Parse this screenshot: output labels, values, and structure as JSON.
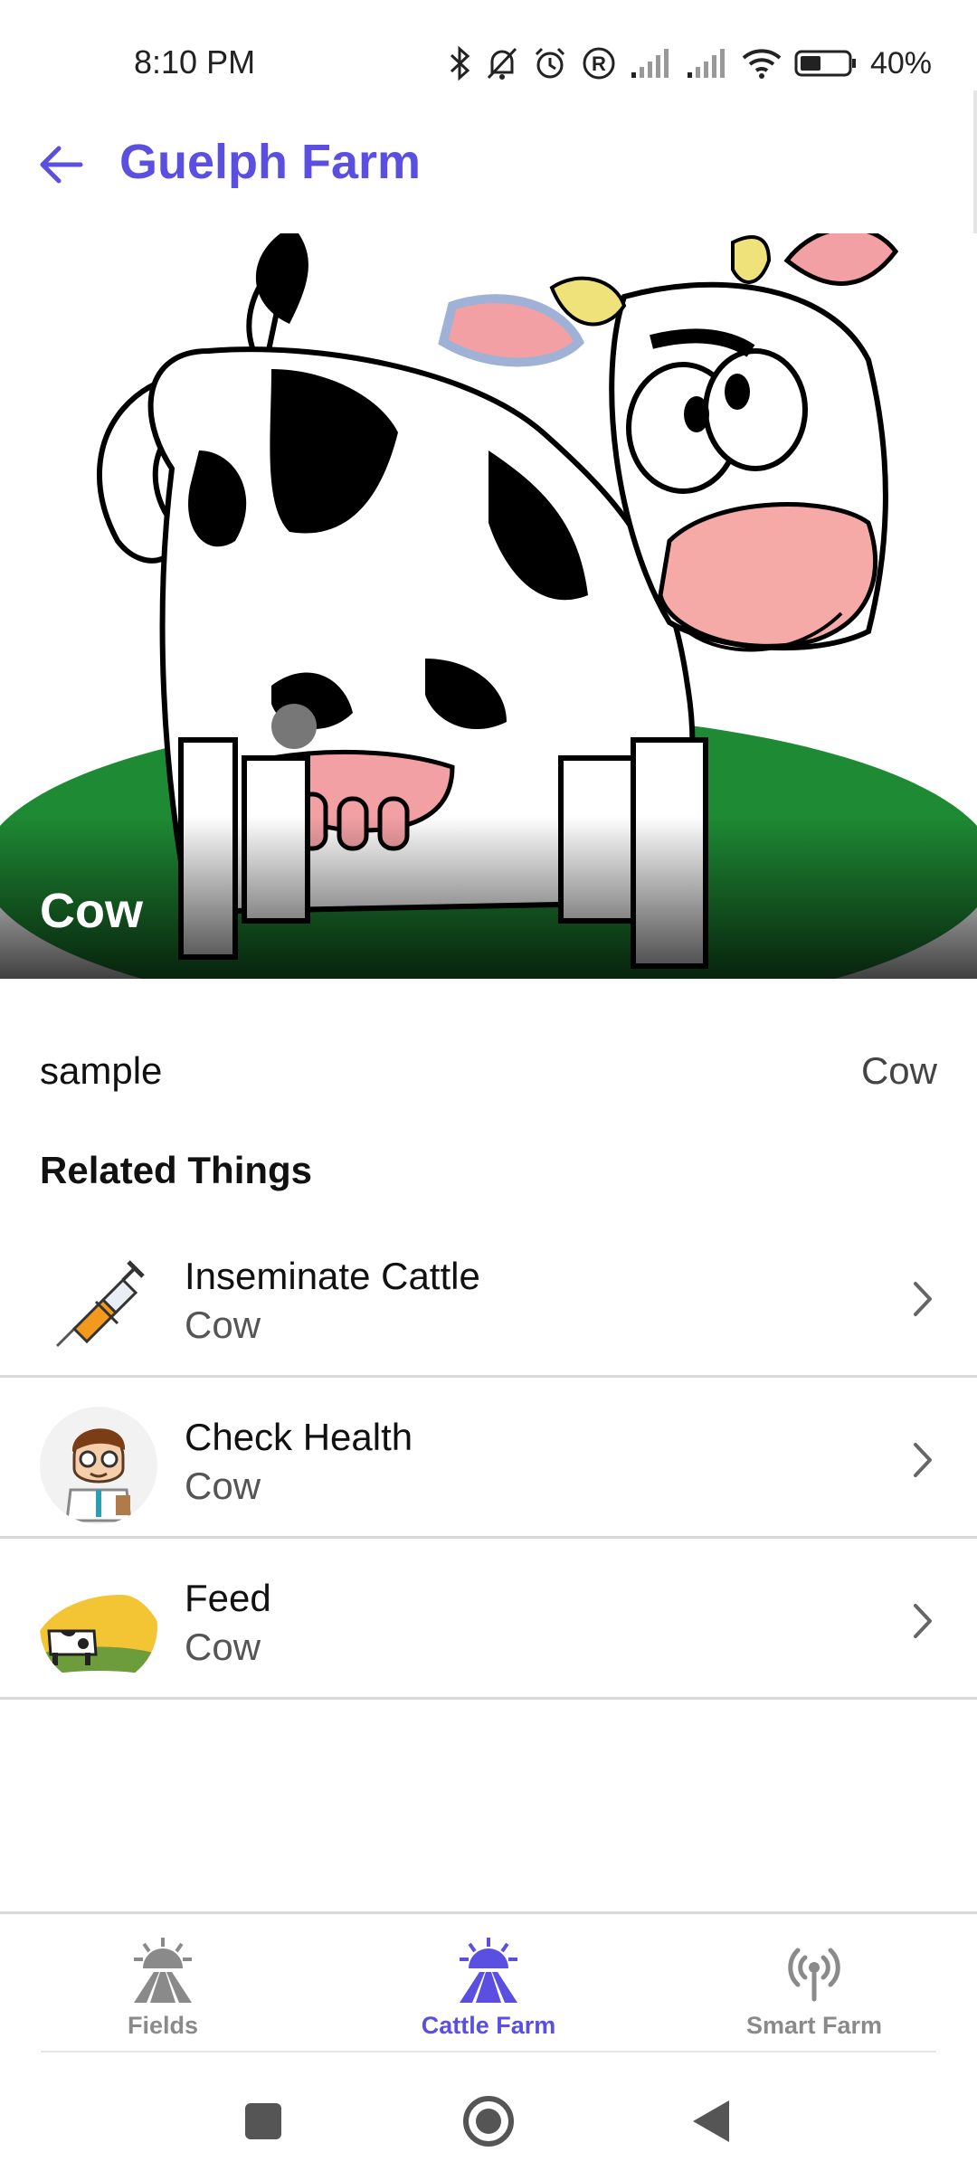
{
  "status_bar": {
    "time": "8:10 PM",
    "battery": "40%"
  },
  "app_bar": {
    "title": "Guelph Farm"
  },
  "hero": {
    "title": "Cow"
  },
  "info": {
    "label": "sample",
    "value": "Cow"
  },
  "related": {
    "heading": "Related Things",
    "items": [
      {
        "title": "Inseminate Cattle",
        "subtitle": "Cow",
        "icon": "syringe-icon"
      },
      {
        "title": "Check Health",
        "subtitle": "Cow",
        "icon": "doctor-avatar"
      },
      {
        "title": "Feed",
        "subtitle": "Cow",
        "icon": "feed-thumbnail"
      }
    ]
  },
  "bottom_nav": {
    "items": [
      {
        "label": "Fields",
        "icon": "fields-icon",
        "active": false
      },
      {
        "label": "Cattle Farm",
        "icon": "cattle-farm-icon",
        "active": true
      },
      {
        "label": "Smart Farm",
        "icon": "antenna-icon",
        "active": false
      }
    ]
  },
  "colors": {
    "accent": "#5a4fe0",
    "inactive": "#8a8a8a",
    "divider": "#d9d9d9"
  }
}
